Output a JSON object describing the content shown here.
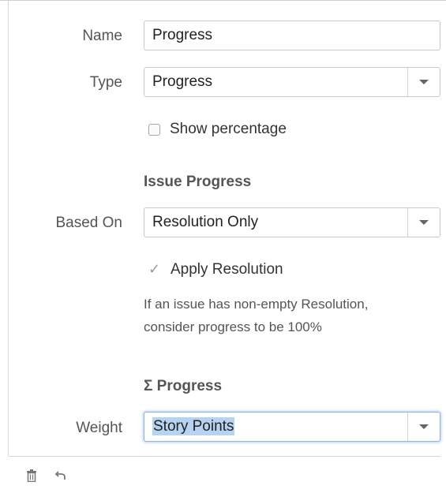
{
  "form": {
    "name_label": "Name",
    "name_value": "Progress",
    "type_label": "Type",
    "type_value": "Progress",
    "show_percentage_label": "Show percentage",
    "show_percentage_checked": false,
    "issue_progress_title": "Issue Progress",
    "based_on_label": "Based On",
    "based_on_value": "Resolution Only",
    "apply_resolution_label": "Apply Resolution",
    "apply_resolution_checked": true,
    "help_line1": "If an issue has non-empty Resolution,",
    "help_line2": "consider progress to be 100%",
    "sigma_progress_title": "Σ Progress",
    "weight_label": "Weight",
    "weight_value": "Story Points"
  },
  "icons": {
    "dropdown": "chevron-down-icon",
    "delete": "trash-icon",
    "undo": "undo-icon",
    "check": "checkmark-icon"
  },
  "colors": {
    "selection_highlight": "#b7d3f2",
    "focus_ring": "#8fb5e0",
    "label_text": "#555555",
    "border": "#c9c9c9"
  }
}
